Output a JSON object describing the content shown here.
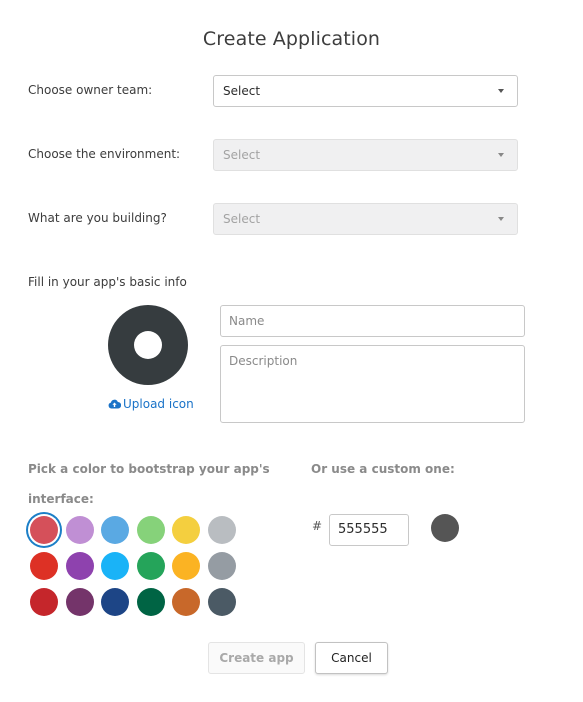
{
  "header": {
    "title": "Create Application"
  },
  "form": {
    "owner_team": {
      "label": "Choose owner team:",
      "value": "Select",
      "disabled": false
    },
    "environment": {
      "label": "Choose the environment:",
      "value": "Select",
      "disabled": true
    },
    "building": {
      "label": "What are you building?",
      "value": "Select",
      "disabled": true
    },
    "basic_info": {
      "label": "Fill in your app's basic info",
      "upload_label": "Upload icon",
      "upload_icon": "cloud-upload-icon",
      "name_placeholder": "Name",
      "description_placeholder": "Description"
    },
    "color_picker": {
      "label_line1": "Pick a color to bootstrap your app's",
      "label_line2": "interface:",
      "selected_index": 0,
      "swatches": [
        [
          "#d5505a",
          "#c08fd4",
          "#5aa9e3",
          "#86d27a",
          "#f4cf3f",
          "#b9bdc1"
        ],
        [
          "#dd3125",
          "#8e42ae",
          "#1ab3f7",
          "#25a45a",
          "#fbb323",
          "#959ca3"
        ],
        [
          "#c5262b",
          "#74346a",
          "#1d4586",
          "#006444",
          "#c8682a",
          "#4b5a65"
        ]
      ]
    },
    "custom_color": {
      "label": "Or use a custom one:",
      "hash": "#",
      "value": "555555",
      "preview_color": "#555555"
    }
  },
  "actions": {
    "create_label": "Create app",
    "create_disabled": true,
    "cancel_label": "Cancel"
  }
}
